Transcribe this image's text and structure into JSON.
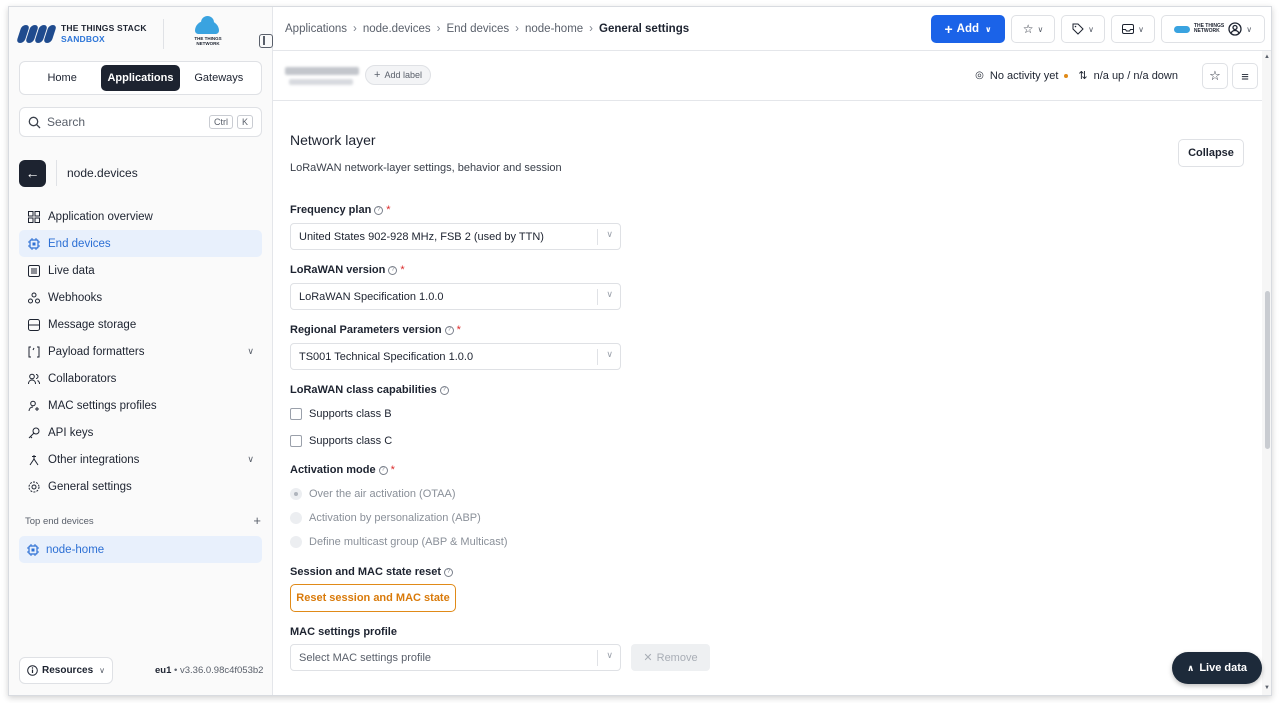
{
  "brand": {
    "line1": "THE THINGS STACK",
    "line2": "SANDBOX",
    "network_line1": "THE THINGS",
    "network_line2": "NETWORK"
  },
  "tabs": [
    "Home",
    "Applications",
    "Gateways"
  ],
  "active_tab": "Applications",
  "search": {
    "placeholder": "Search",
    "key1": "Ctrl",
    "key2": "K"
  },
  "back": {
    "label": "node.devices"
  },
  "nav": [
    {
      "label": "Application overview",
      "icon": "grid-icon"
    },
    {
      "label": "End devices",
      "icon": "chip-icon",
      "active": true
    },
    {
      "label": "Live data",
      "icon": "list-icon"
    },
    {
      "label": "Webhooks",
      "icon": "webhook-icon"
    },
    {
      "label": "Message storage",
      "icon": "database-icon"
    },
    {
      "label": "Payload formatters",
      "icon": "braces-icon",
      "expandable": true
    },
    {
      "label": "Collaborators",
      "icon": "users-icon"
    },
    {
      "label": "MAC settings profiles",
      "icon": "user-plus-icon"
    },
    {
      "label": "API keys",
      "icon": "key-icon"
    },
    {
      "label": "Other integrations",
      "icon": "integration-icon",
      "expandable": true
    },
    {
      "label": "General settings",
      "icon": "gear-icon"
    }
  ],
  "top_devices": {
    "label": "Top end devices",
    "items": [
      "node-home"
    ]
  },
  "footer": {
    "resources": "Resources",
    "region": "eu1",
    "version": "v3.36.0.98c4f053b2"
  },
  "breadcrumbs": [
    "Applications",
    "node.devices",
    "End devices",
    "node-home"
  ],
  "breadcrumb_current": "General settings",
  "topbar": {
    "add_label": "Add"
  },
  "subheader": {
    "add_label": "Add label",
    "activity": "No activity yet",
    "traffic": "n/a up / n/a down"
  },
  "section": {
    "title": "Network layer",
    "description": "LoRaWAN network-layer settings, behavior and session",
    "collapse": "Collapse"
  },
  "fields": {
    "frequency_plan": {
      "label": "Frequency plan",
      "value": "United States 902-928 MHz, FSB 2 (used by TTN)"
    },
    "lorawan_version": {
      "label": "LoRaWAN version",
      "value": "LoRaWAN Specification 1.0.0"
    },
    "regional_params": {
      "label": "Regional Parameters version",
      "value": "TS001 Technical Specification 1.0.0"
    },
    "class_caps": {
      "label": "LoRaWAN class capabilities",
      "class_b": "Supports class B",
      "class_c": "Supports class C"
    },
    "activation": {
      "label": "Activation mode",
      "otaa": "Over the air activation (OTAA)",
      "abp": "Activation by personalization (ABP)",
      "multicast": "Define multicast group (ABP & Multicast)"
    },
    "session_reset": {
      "label": "Session and MAC state reset",
      "button": "Reset session and MAC state"
    },
    "mac_profile": {
      "label": "MAC settings profile",
      "placeholder": "Select MAC settings profile",
      "remove": "Remove"
    }
  },
  "live_data": "Live data",
  "colors": {
    "primary": "#1b63e8",
    "dark": "#1d2330",
    "accent_orange": "#e08a18",
    "active_bg": "#e8f0fc",
    "required": "#db2b2b"
  }
}
